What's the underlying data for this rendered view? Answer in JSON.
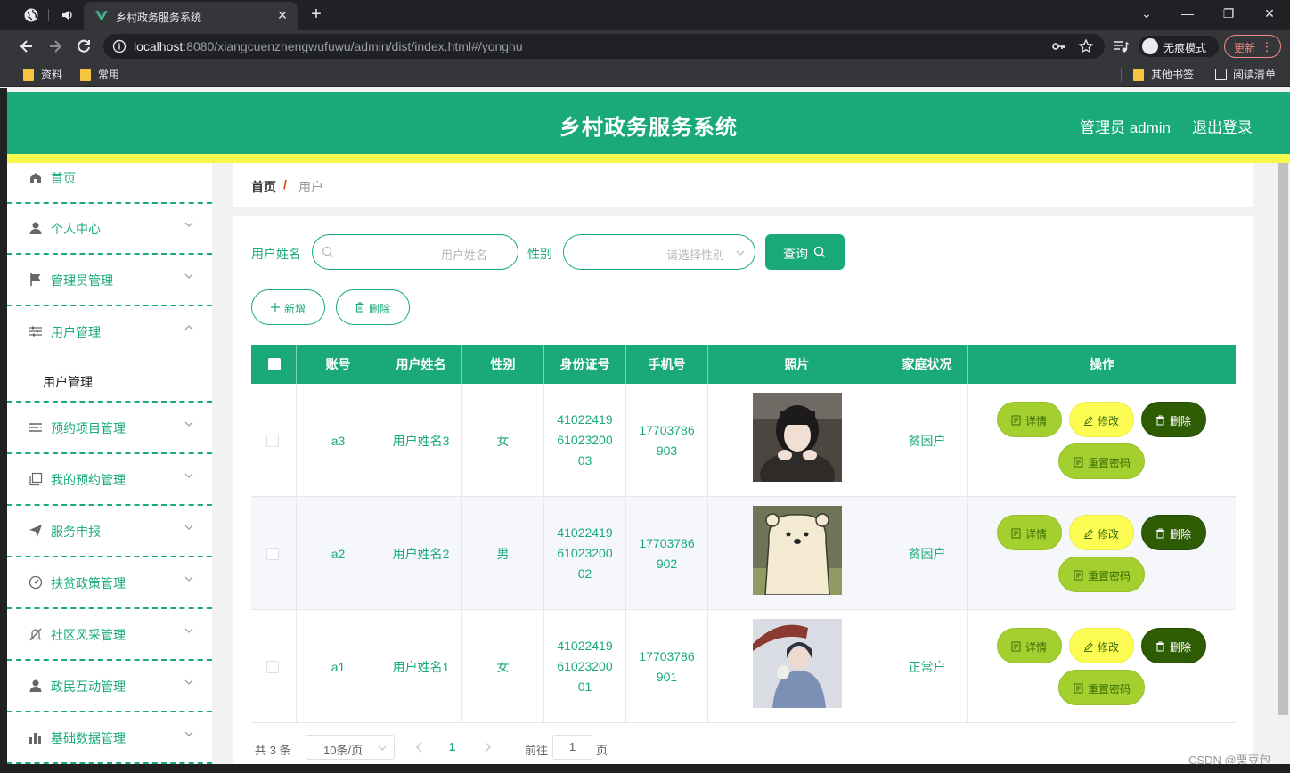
{
  "browser": {
    "tab_title": "乡村政务服务系统",
    "url_host": "localhost",
    "url_rest": ":8080/xiangcuenzhengwufuwu/admin/dist/index.html#/yonghu",
    "incognito_label": "无痕模式",
    "update_label": "更新",
    "bookmarks": [
      "资料",
      "常用",
      "其他书签",
      "阅读清单"
    ]
  },
  "header": {
    "title": "乡村政务服务系统",
    "admin": "管理员 admin",
    "logout": "退出登录"
  },
  "sidebar": {
    "items": [
      {
        "label": "首页",
        "icon": "home-icon"
      },
      {
        "label": "个人中心",
        "icon": "user-icon"
      },
      {
        "label": "管理员管理",
        "icon": "flag-icon"
      },
      {
        "label": "用户管理",
        "icon": "sliders-icon",
        "sub": "用户管理"
      },
      {
        "label": "预约项目管理",
        "icon": "list-icon"
      },
      {
        "label": "我的预约管理",
        "icon": "copy-icon"
      },
      {
        "label": "服务申报",
        "icon": "send-icon"
      },
      {
        "label": "扶贫政策管理",
        "icon": "gauge-icon"
      },
      {
        "label": "社区风采管理",
        "icon": "bell-off-icon"
      },
      {
        "label": "政民互动管理",
        "icon": "user-icon"
      },
      {
        "label": "基础数据管理",
        "icon": "bar-chart-icon"
      }
    ]
  },
  "breadcrumb": {
    "home": "首页",
    "separator": "/",
    "current": "用户"
  },
  "search": {
    "name_label": "用户姓名",
    "name_placeholder": "用户姓名",
    "gender_label": "性别",
    "gender_placeholder": "请选择性别",
    "query_label": "查询"
  },
  "actions": {
    "add_label": "新增",
    "delete_label": "删除"
  },
  "table": {
    "columns": [
      "账号",
      "用户姓名",
      "性别",
      "身份证号",
      "手机号",
      "照片",
      "家庭状况",
      "操作"
    ],
    "rows": [
      {
        "account": "a3",
        "name": "用户姓名3",
        "gender": "女",
        "id_number": "410224196102320003",
        "phone": "17703786903",
        "family": "贫困户"
      },
      {
        "account": "a2",
        "name": "用户姓名2",
        "gender": "男",
        "id_number": "410224196102320002",
        "phone": "17703786902",
        "family": "贫困户"
      },
      {
        "account": "a1",
        "name": "用户姓名1",
        "gender": "女",
        "id_number": "410224196102320001",
        "phone": "17703786901",
        "family": "正常户"
      }
    ],
    "row_actions": {
      "detail": "详情",
      "edit": "修改",
      "delete": "删除",
      "reset": "重置密码"
    }
  },
  "pagination": {
    "total": "共 3 条",
    "page_size": "10条/页",
    "current_page": "1",
    "goto_label": "前往",
    "goto_value": "1",
    "page_unit": "页"
  },
  "watermark": "CSDN @栗豆包",
  "colors": {
    "primary": "#1aaa7a",
    "yellow": "#f5f74c",
    "detail": "#a3d02e",
    "edit": "#fcfc52",
    "delete": "#2e5c04"
  }
}
